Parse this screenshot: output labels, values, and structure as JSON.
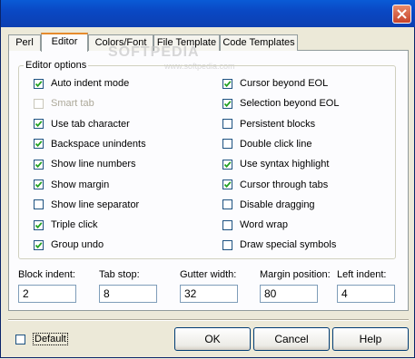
{
  "watermark": {
    "main": "SOFTPEDIA",
    "sub": "www.softpedia.com"
  },
  "tabs": [
    {
      "label": "Perl",
      "active": false
    },
    {
      "label": "Editor",
      "active": true
    },
    {
      "label": "Colors/Font",
      "active": false
    },
    {
      "label": "File Template",
      "active": false
    },
    {
      "label": "Code Templates",
      "active": false
    }
  ],
  "group_title": "Editor options",
  "left_options": [
    {
      "label": "Auto indent mode",
      "checked": true,
      "enabled": true
    },
    {
      "label": "Smart tab",
      "checked": false,
      "enabled": false
    },
    {
      "label": "Use tab character",
      "checked": true,
      "enabled": true
    },
    {
      "label": "Backspace unindents",
      "checked": true,
      "enabled": true
    },
    {
      "label": "Show line numbers",
      "checked": true,
      "enabled": true
    },
    {
      "label": "Show margin",
      "checked": true,
      "enabled": true
    },
    {
      "label": "Show line separator",
      "checked": false,
      "enabled": true
    },
    {
      "label": "Triple click",
      "checked": true,
      "enabled": true
    },
    {
      "label": "Group undo",
      "checked": true,
      "enabled": true
    }
  ],
  "right_options": [
    {
      "label": "Cursor beyond EOL",
      "checked": true,
      "enabled": true
    },
    {
      "label": "Selection beyond EOL",
      "checked": true,
      "enabled": true
    },
    {
      "label": "Persistent blocks",
      "checked": false,
      "enabled": true
    },
    {
      "label": "Double click line",
      "checked": false,
      "enabled": true
    },
    {
      "label": "Use syntax highlight",
      "checked": true,
      "enabled": true
    },
    {
      "label": "Cursor through tabs",
      "checked": true,
      "enabled": true
    },
    {
      "label": "Disable dragging",
      "checked": false,
      "enabled": true
    },
    {
      "label": "Word wrap",
      "checked": false,
      "enabled": true
    },
    {
      "label": "Draw special symbols",
      "checked": false,
      "enabled": true
    }
  ],
  "fields": [
    {
      "label": "Block indent:",
      "value": "2"
    },
    {
      "label": "Tab stop:",
      "value": "8"
    },
    {
      "label": "Gutter width:",
      "value": "32"
    },
    {
      "label": "Margin position:",
      "value": "80"
    },
    {
      "label": "Left indent:",
      "value": "4"
    }
  ],
  "default_checkbox": {
    "label": "Default",
    "checked": false
  },
  "buttons": {
    "ok": "OK",
    "cancel": "Cancel",
    "help": "Help"
  },
  "colors": {
    "titlebar": "#0a48c4",
    "tab_highlight": "#e68b2c",
    "check": "#21a121"
  }
}
